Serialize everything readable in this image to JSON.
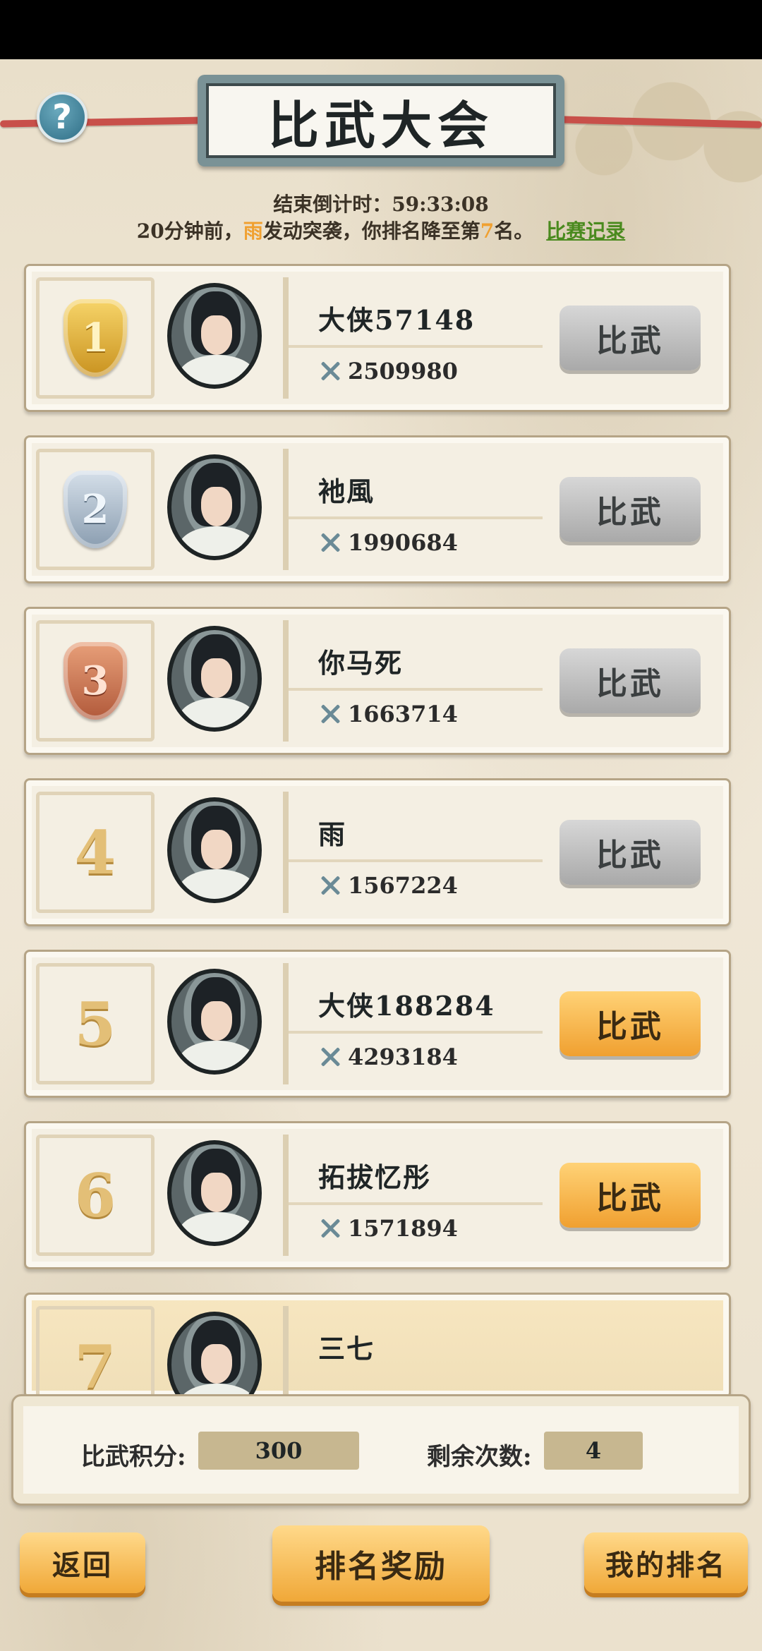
{
  "header": {
    "title": "比武大会",
    "help_symbol": "?"
  },
  "countdown": {
    "text": "结束倒计时：59:33:08"
  },
  "notice": {
    "prefix": "20分钟前，",
    "attacker": "雨",
    "middle": "发动突袭，你排名降至第",
    "rank": "7",
    "suffix": "名。",
    "link_label": "比赛记录"
  },
  "duel_label": "比武",
  "players": [
    {
      "rank": "1",
      "medal": "gold",
      "name": "大侠57148",
      "power": "2509980",
      "button_state": "gray"
    },
    {
      "rank": "2",
      "medal": "silver",
      "name": "衪風",
      "power": "1990684",
      "button_state": "gray"
    },
    {
      "rank": "3",
      "medal": "bronze",
      "name": "你马死",
      "power": "1663714",
      "button_state": "gray"
    },
    {
      "rank": "4",
      "medal": "",
      "name": "雨",
      "power": "1567224",
      "button_state": "gray"
    },
    {
      "rank": "5",
      "medal": "",
      "name": "大侠188284",
      "power": "4293184",
      "button_state": "orange"
    },
    {
      "rank": "6",
      "medal": "",
      "name": "拓拔忆彤",
      "power": "1571894",
      "button_state": "orange"
    },
    {
      "rank": "7",
      "medal": "",
      "name": "三七",
      "power": "",
      "button_state": "self"
    }
  ],
  "stats": {
    "score_label": "比武积分:",
    "score_value": "300",
    "remaining_label": "剩余次数:",
    "remaining_value": "4"
  },
  "bottom": {
    "back_label": "返回",
    "rewards_label": "排名奖励",
    "my_rank_label": "我的排名"
  },
  "colors": {
    "highlight": "#f0a030",
    "link": "#4a8a1e",
    "button_orange": "#f0a030",
    "button_gray": "#a9a9a9"
  }
}
